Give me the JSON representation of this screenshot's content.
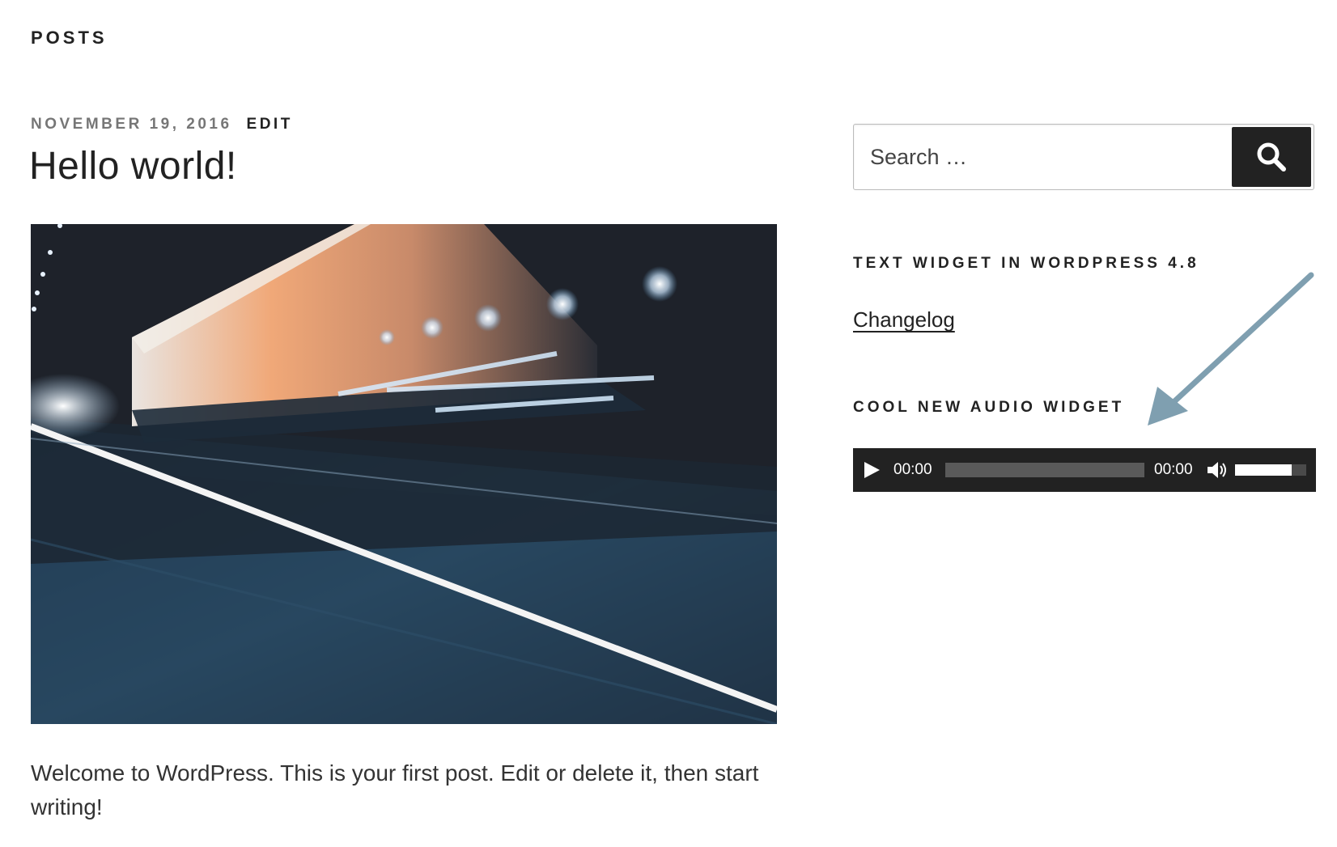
{
  "page": {
    "section_title": "POSTS"
  },
  "post": {
    "date": "NOVEMBER 19, 2016",
    "edit_label": "EDIT",
    "title": "Hello world!",
    "image_alt": "night tunnel motion blur photo",
    "content": "Welcome to WordPress. This is your first post. Edit or delete it, then start writing!"
  },
  "sidebar": {
    "search": {
      "placeholder": "Search …",
      "button_icon": "search-icon"
    },
    "text_widget": {
      "title": "TEXT WIDGET IN WORDPRESS 4.8",
      "link_label": "Changelog"
    },
    "audio_widget": {
      "title": "COOL NEW AUDIO WIDGET",
      "current_time": "00:00",
      "duration": "00:00",
      "progress": 0,
      "volume": 0.8,
      "play_icon": "play-icon",
      "mute_icon": "speaker-icon"
    }
  },
  "annotation": {
    "icon": "arrow-icon",
    "color": "#7f9fb0"
  },
  "colors": {
    "text": "#222222",
    "meta": "#767676",
    "player_bg": "#222222"
  }
}
